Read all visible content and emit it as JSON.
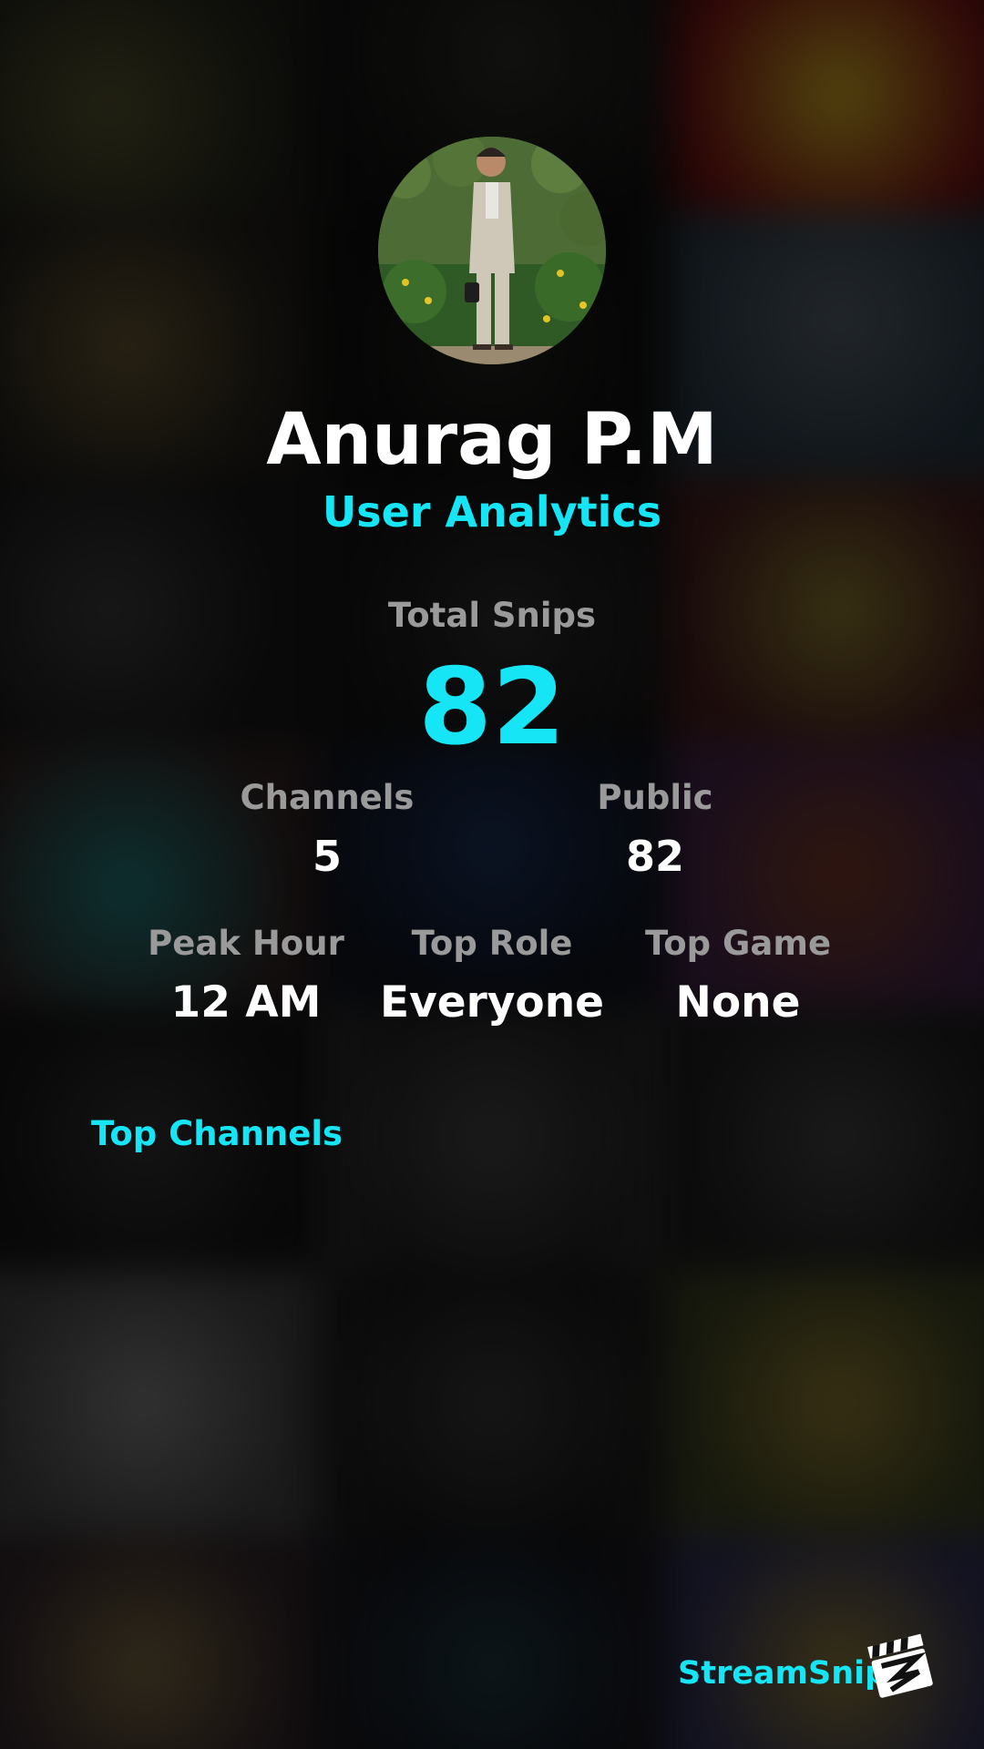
{
  "profile": {
    "name": "Anurag P.M",
    "subtitle": "User Analytics"
  },
  "stats": {
    "total_snips": {
      "label": "Total Snips",
      "value": "82"
    },
    "channels": {
      "label": "Channels",
      "value": "5"
    },
    "public": {
      "label": "Public",
      "value": "82"
    },
    "peak_hour": {
      "label": "Peak Hour",
      "value": "12 AM"
    },
    "top_role": {
      "label": "Top Role",
      "value": "Everyone"
    },
    "top_game": {
      "label": "Top Game",
      "value": "None"
    }
  },
  "top_channels": {
    "title": "Top Channels"
  },
  "footer": {
    "brand": "StreamSnip",
    "logo_icon": "clapperboard-icon"
  },
  "colors": {
    "accent": "#15e5f5",
    "label": "#9a9a9a",
    "value": "#ffffff"
  }
}
